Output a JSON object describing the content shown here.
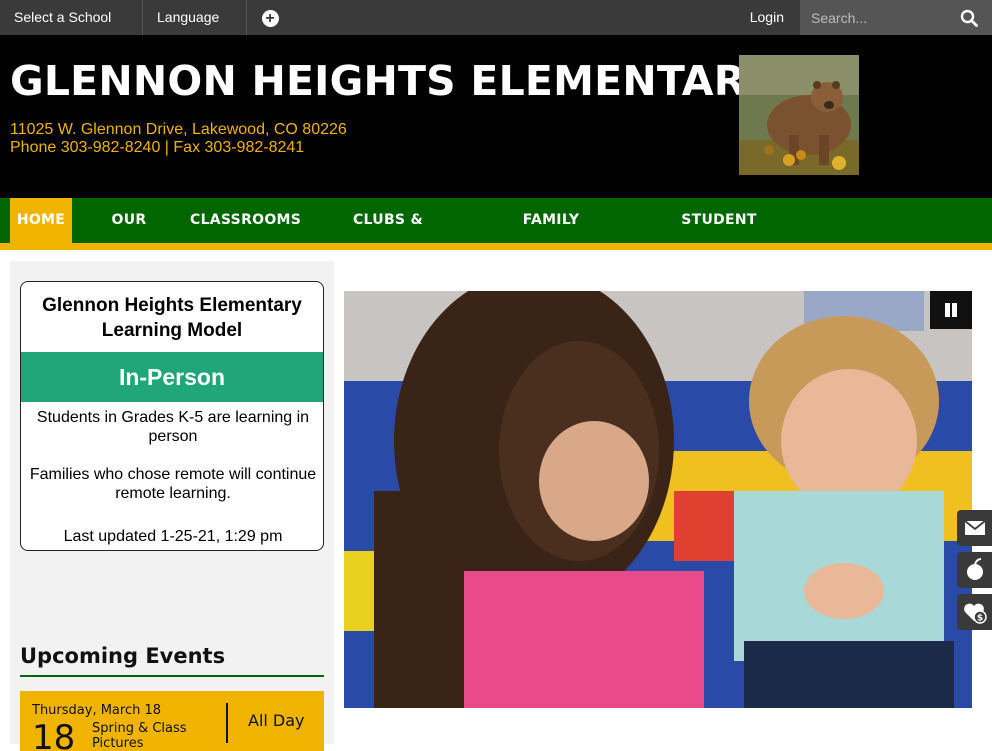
{
  "topbar": {
    "select_school": "Select a School",
    "language": "Language",
    "login": "Login",
    "search_placeholder": "Search..."
  },
  "header": {
    "school_name": "GLENNON HEIGHTS ELEMENTARY",
    "address": "11025 W. Glennon Drive, Lakewood, CO 80226",
    "phone_fax": "Phone 303-982-8240 | Fax 303-982-8241"
  },
  "nav": {
    "items": [
      {
        "label": "HOME",
        "active": true
      },
      {
        "label": "OUR SCHOOL"
      },
      {
        "label": "CLASSROOMS"
      },
      {
        "label": "CLUBS & PROGRAMS"
      },
      {
        "label": "FAMILY RESOURCES"
      },
      {
        "label": "STUDENT RESOURCES"
      }
    ]
  },
  "learning_model": {
    "title": "Glennon Heights Elementary Learning Model",
    "mode": "In-Person",
    "line1": "Students in Grades K-5 are learning in person",
    "line2": "Families who chose remote will continue remote learning.",
    "updated": "Last updated 1-25-21, 1:29 pm"
  },
  "events": {
    "title": "Upcoming Events",
    "items": [
      {
        "date": "Thursday, March 18",
        "day": "18",
        "name": "Spring & Class Pictures",
        "time": "All Day"
      }
    ]
  },
  "colors": {
    "green": "#006600",
    "gold": "#f0b400",
    "teal": "#21a67a",
    "black": "#000000"
  },
  "icons": [
    "chevron-updown-icon",
    "plus-circle-icon",
    "search-icon",
    "pause-icon",
    "envelope-icon",
    "apple-icon",
    "heart-dollar-icon"
  ]
}
